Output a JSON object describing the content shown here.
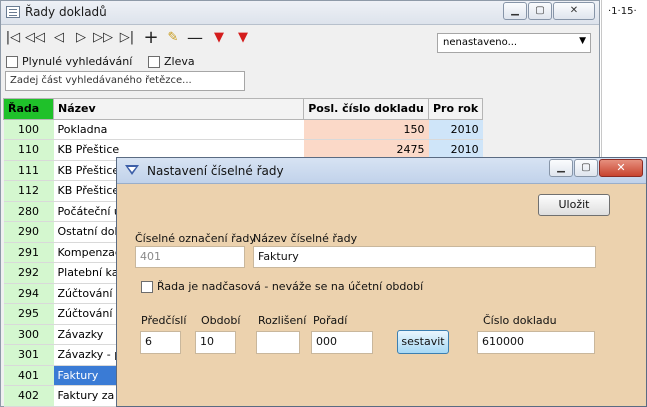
{
  "main_window": {
    "title": "Řady dokladů",
    "toolbar": {
      "buttons": [
        "first-icon",
        "prev-page-icon",
        "prev-icon",
        "next-icon",
        "next-page-icon",
        "last-icon",
        "add-icon",
        "edit-icon",
        "delete-icon",
        "filter-icon",
        "clear-filter-icon"
      ]
    },
    "combo_value": "nenastaveno...",
    "checkbox_smooth_label": "Plynulé vyhledávání",
    "checkbox_left_label": "Zleva",
    "search_placeholder": "Zadej část vyhledávaného řetězce...",
    "table": {
      "headers": [
        "Řada",
        "Název",
        "Posl. číslo dokladu",
        "Pro rok"
      ],
      "rows": [
        {
          "code": "100",
          "name": "Pokladna",
          "num": "150",
          "year": "2010"
        },
        {
          "code": "110",
          "name": "KB Přeštice",
          "num": "2475",
          "year": "2010"
        },
        {
          "code": "111",
          "name": "KB Přeštice",
          "num": "",
          "year": ""
        },
        {
          "code": "112",
          "name": "KB Přeštice",
          "num": "",
          "year": ""
        },
        {
          "code": "280",
          "name": "Počáteční ú",
          "num": "",
          "year": ""
        },
        {
          "code": "290",
          "name": "Ostatní dokla",
          "num": "",
          "year": ""
        },
        {
          "code": "291",
          "name": "Kompenzace",
          "num": "",
          "year": ""
        },
        {
          "code": "292",
          "name": "Platební kart",
          "num": "",
          "year": ""
        },
        {
          "code": "294",
          "name": "Zúčtování Dl",
          "num": "",
          "year": ""
        },
        {
          "code": "295",
          "name": "Zúčtování m",
          "num": "",
          "year": ""
        },
        {
          "code": "300",
          "name": "Závazky",
          "num": "",
          "year": ""
        },
        {
          "code": "301",
          "name": "Závazky - pl",
          "num": "",
          "year": ""
        },
        {
          "code": "401",
          "name": "Faktury",
          "num": "",
          "year": ""
        },
        {
          "code": "402",
          "name": "Faktury za V",
          "num": "",
          "year": ""
        }
      ]
    }
  },
  "right_panel_text": "·1·15·",
  "dialog": {
    "title": "Nastavení číselné řady",
    "save_label": "Uložit",
    "label_number_designation": "Číselné označení řady",
    "value_number_designation": "401",
    "label_series_name": "Název číselné řady",
    "value_series_name": "Faktury",
    "checkbox_label": "Řada je nadčasová  - neváže se na účetní období",
    "label_prefix": "Předčíslí",
    "value_prefix": "6",
    "label_period": "Období",
    "value_period": "10",
    "label_distinction": "Rozlišení",
    "value_distinction": "",
    "label_order": "Pořadí",
    "value_order": "000",
    "compose_label": "sestavit",
    "label_doc_number": "Číslo dokladu",
    "value_doc_number": "610000"
  },
  "colors": {
    "rada_header": "#1fc12a",
    "code_cell": "#d4f7cf",
    "num_cell": "#fbd9c8",
    "year_cell": "#cfe5f9",
    "dialog_bg": "#ecd2ae",
    "selected_row": "#3a7bd5"
  }
}
